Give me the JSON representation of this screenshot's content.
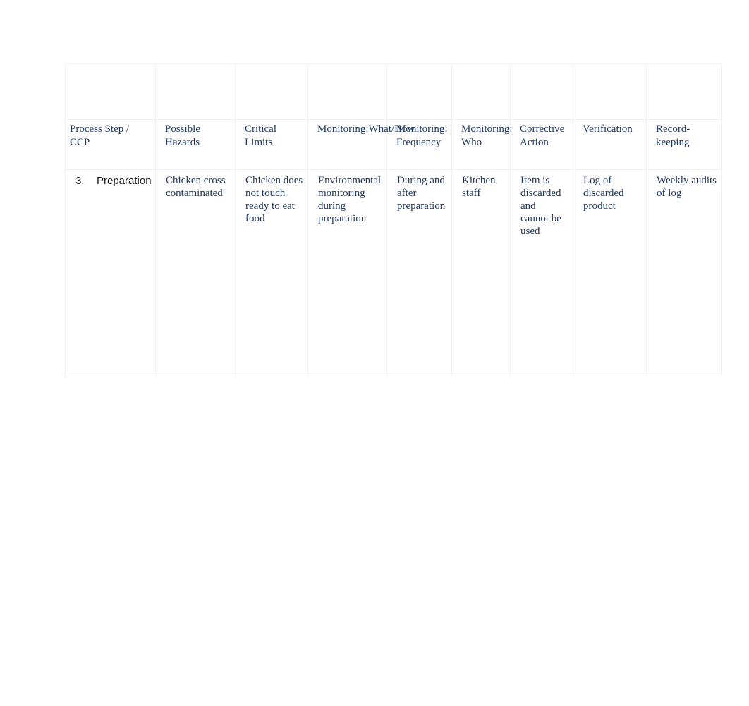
{
  "document": {
    "background_color": "#ffffff",
    "text_color": "#1f3864",
    "list_text_color": "#1a1a1a",
    "border_color": "#f1f1f3"
  },
  "table": {
    "blank_row_cells": [
      "",
      "",
      "",
      "",
      "",
      "",
      "",
      "",
      ""
    ],
    "headers": [
      "Process Step / CCP",
      "Possible Hazards",
      "Critical Limits",
      "Monitoring:What/How",
      "Monitoring: Frequency",
      "Monitoring: \n  Who",
      "Corrective Action",
      "Verification",
      "Record-keeping"
    ],
    "rows": [
      {
        "step_number": "3.",
        "step_label": "Preparation",
        "cells": [
          "Chicken cross contaminated",
          "Chicken does not touch ready to eat food",
          "Environmental monitoring during preparation",
          "During and after preparation",
          "Kitchen staff",
          "Item is discarded and \n      cannot be used",
          "Log of discarded product",
          "Weekly audits of log"
        ]
      }
    ]
  }
}
